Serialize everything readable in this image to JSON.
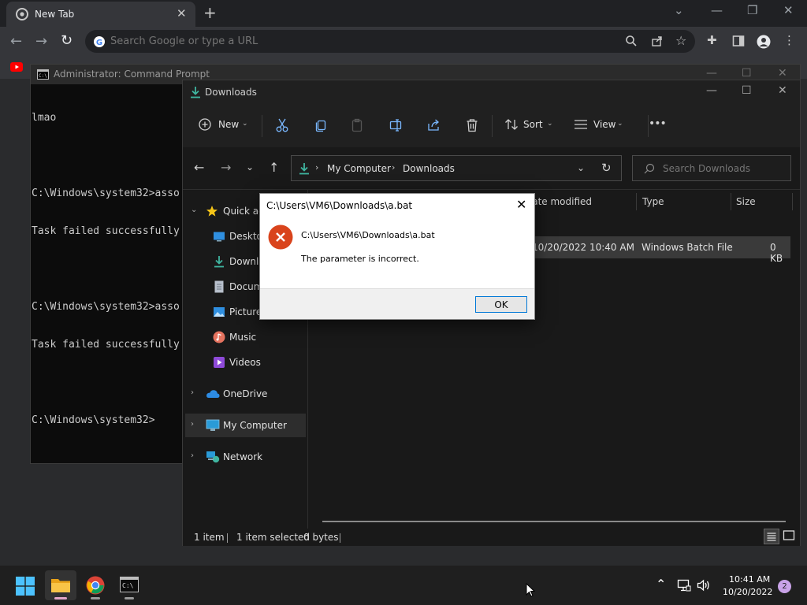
{
  "chrome": {
    "tab_title": "New Tab",
    "new_tab": "+",
    "omnibox_placeholder": "Search Google or type a URL"
  },
  "cmd": {
    "title": "Administrator: Command Prompt",
    "lines": [
      "lmao",
      "",
      "C:\\Windows\\system32>asso",
      "Task failed successfully",
      "",
      "C:\\Windows\\system32>asso",
      "Task failed successfully",
      "",
      "C:\\Windows\\system32>"
    ]
  },
  "explorer": {
    "title": "Downloads",
    "toolbar": {
      "new_label": "New",
      "sort_label": "Sort",
      "view_label": "View",
      "more": "•••"
    },
    "breadcrumb": [
      "My Computer",
      "Downloads"
    ],
    "search_placeholder": "Search Downloads",
    "nav": {
      "quick_access": "Quick access",
      "desktop": "Desktop",
      "downloads": "Downloads",
      "documents": "Documents",
      "pictures": "Pictures",
      "music": "Music",
      "videos": "Videos",
      "onedrive": "OneDrive",
      "my_computer": "My Computer",
      "network": "Network"
    },
    "columns": {
      "date": "Date modified",
      "type": "Type",
      "size": "Size"
    },
    "file": {
      "date": "10/20/2022 10:40 AM",
      "type": "Windows Batch File",
      "size": "0 KB"
    },
    "status": {
      "items": "1 item",
      "selected": "1 item selected",
      "bytes": "0 bytes"
    }
  },
  "dialog": {
    "title": "C:\\Users\\VM6\\Downloads\\a.bat",
    "path": "C:\\Users\\VM6\\Downloads\\a.bat",
    "message": "The parameter is incorrect.",
    "ok_label": "OK"
  },
  "taskbar": {
    "time": "10:41 AM",
    "date": "10/20/2022",
    "notification_count": "2"
  },
  "colors": {
    "chrome_bg": "#202124",
    "explorer_accent": "#7ab8ff",
    "error_red": "#d9441c",
    "ok_border": "#0078d7"
  }
}
